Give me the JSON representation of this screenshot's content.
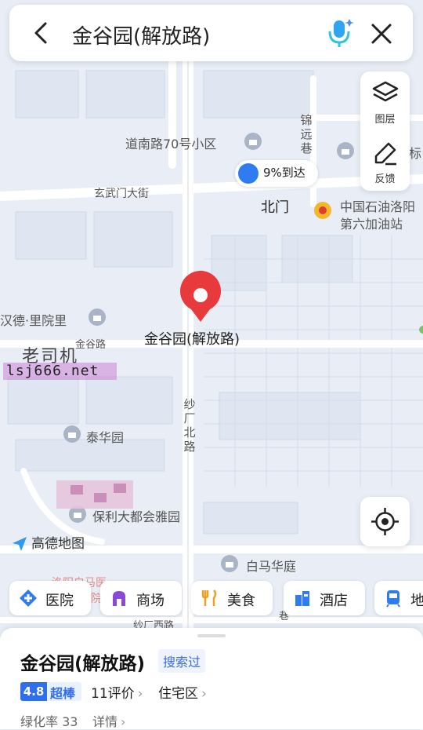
{
  "search": {
    "title": "金谷园(解放路)"
  },
  "side_tools": [
    {
      "label": "图层",
      "icon": "layers-icon"
    },
    {
      "label": "反馈",
      "icon": "pencil-icon"
    }
  ],
  "map_labels": {
    "daonan": "道南路70号小区",
    "xuanwumen": "玄武门大街",
    "beimen": "北门",
    "petro1": "中国石油洛阳",
    "petro2": "第六加油站",
    "handeli": "汉德·里院里",
    "jingulu": "金谷路",
    "marker": "金谷园(解放路)",
    "taihua": "泰华园",
    "baoli": "保利大都会雅园",
    "baimahuating": "白马华庭",
    "shachangbeilu": "纱厂北路",
    "jinyuanxiang": "锦远巷",
    "biao": "标",
    "xiang": "巷",
    "shachangxilu": "纱厂西路",
    "luoyang_baima": "洛阳白马医",
    "yuan": "院"
  },
  "route_pill": {
    "text": "9%到达"
  },
  "watermark": {
    "line1": "老司机",
    "line2": "lsj666.net"
  },
  "logo": {
    "text": "高德地图"
  },
  "chips": [
    {
      "label": "医院",
      "icon": "hospital-icon",
      "color": "#2f7cf0"
    },
    {
      "label": "商场",
      "icon": "mall-icon",
      "color": "#8b47d6"
    },
    {
      "label": "美食",
      "icon": "food-icon",
      "color": "#f0a020"
    },
    {
      "label": "酒店",
      "icon": "hotel-icon",
      "color": "#2f7cf0"
    },
    {
      "label": "地",
      "icon": "metro-icon",
      "color": "#2f7cf0"
    }
  ],
  "place": {
    "name": "金谷园(解放路)",
    "badge": "搜索过",
    "score": "4.8",
    "score_label": "超棒",
    "reviews": "11评价",
    "category": "住宅区",
    "green_rate": "绿化率 33",
    "detail": "详情"
  },
  "colors": {
    "accent": "#2f6fee",
    "marker": "#e8393c",
    "road": "#ffffff",
    "block": "#d7e0ee",
    "map_bg": "#e9eef6"
  }
}
